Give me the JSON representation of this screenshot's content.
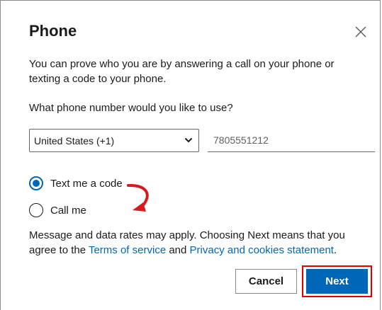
{
  "dialog": {
    "title": "Phone",
    "description": "You can prove who you are by answering a call on your phone or texting a code to your phone.",
    "question": "What phone number would you like to use?"
  },
  "phone": {
    "country": "United States (+1)",
    "number": "7805551212"
  },
  "options": [
    {
      "label": "Text me a code",
      "selected": true
    },
    {
      "label": "Call me",
      "selected": false
    }
  ],
  "notice": {
    "text_before": "Message and data rates may apply. Choosing Next means that you agree to the ",
    "terms_link": "Terms of service",
    "text_middle": " and ",
    "privacy_link": "Privacy and cookies statement",
    "text_after": "."
  },
  "buttons": {
    "cancel": "Cancel",
    "next": "Next"
  },
  "colors": {
    "accent": "#0067b8",
    "highlight": "#e00000",
    "text": "#1b1b1b"
  },
  "icons": {
    "close": "close-icon",
    "chevron": "chevron-down-icon",
    "annotation": "curved-arrow-icon"
  }
}
